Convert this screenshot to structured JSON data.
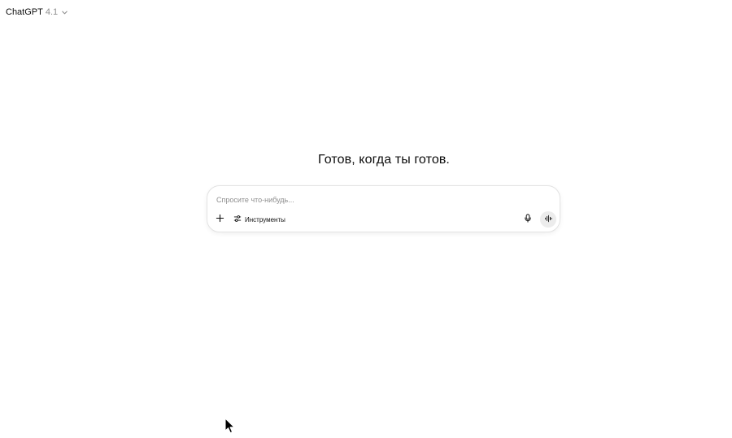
{
  "header": {
    "model_name": "ChatGPT",
    "model_version": "4.1",
    "chevron_icon": "chevron-down-icon"
  },
  "main": {
    "headline": "Готов, когда ты готов."
  },
  "composer": {
    "placeholder": "Спросите что-нибудь...",
    "value": "",
    "add_icon": "plus-icon",
    "tools_icon": "sliders-icon",
    "tools_label": "Инструменты",
    "mic_icon": "microphone-icon",
    "voice_icon": "voice-waveform-icon"
  },
  "colors": {
    "text": "#0d0d0d",
    "muted": "#8f8f8f",
    "border": "#e3e3e3",
    "voice_button_bg": "#ececec"
  }
}
